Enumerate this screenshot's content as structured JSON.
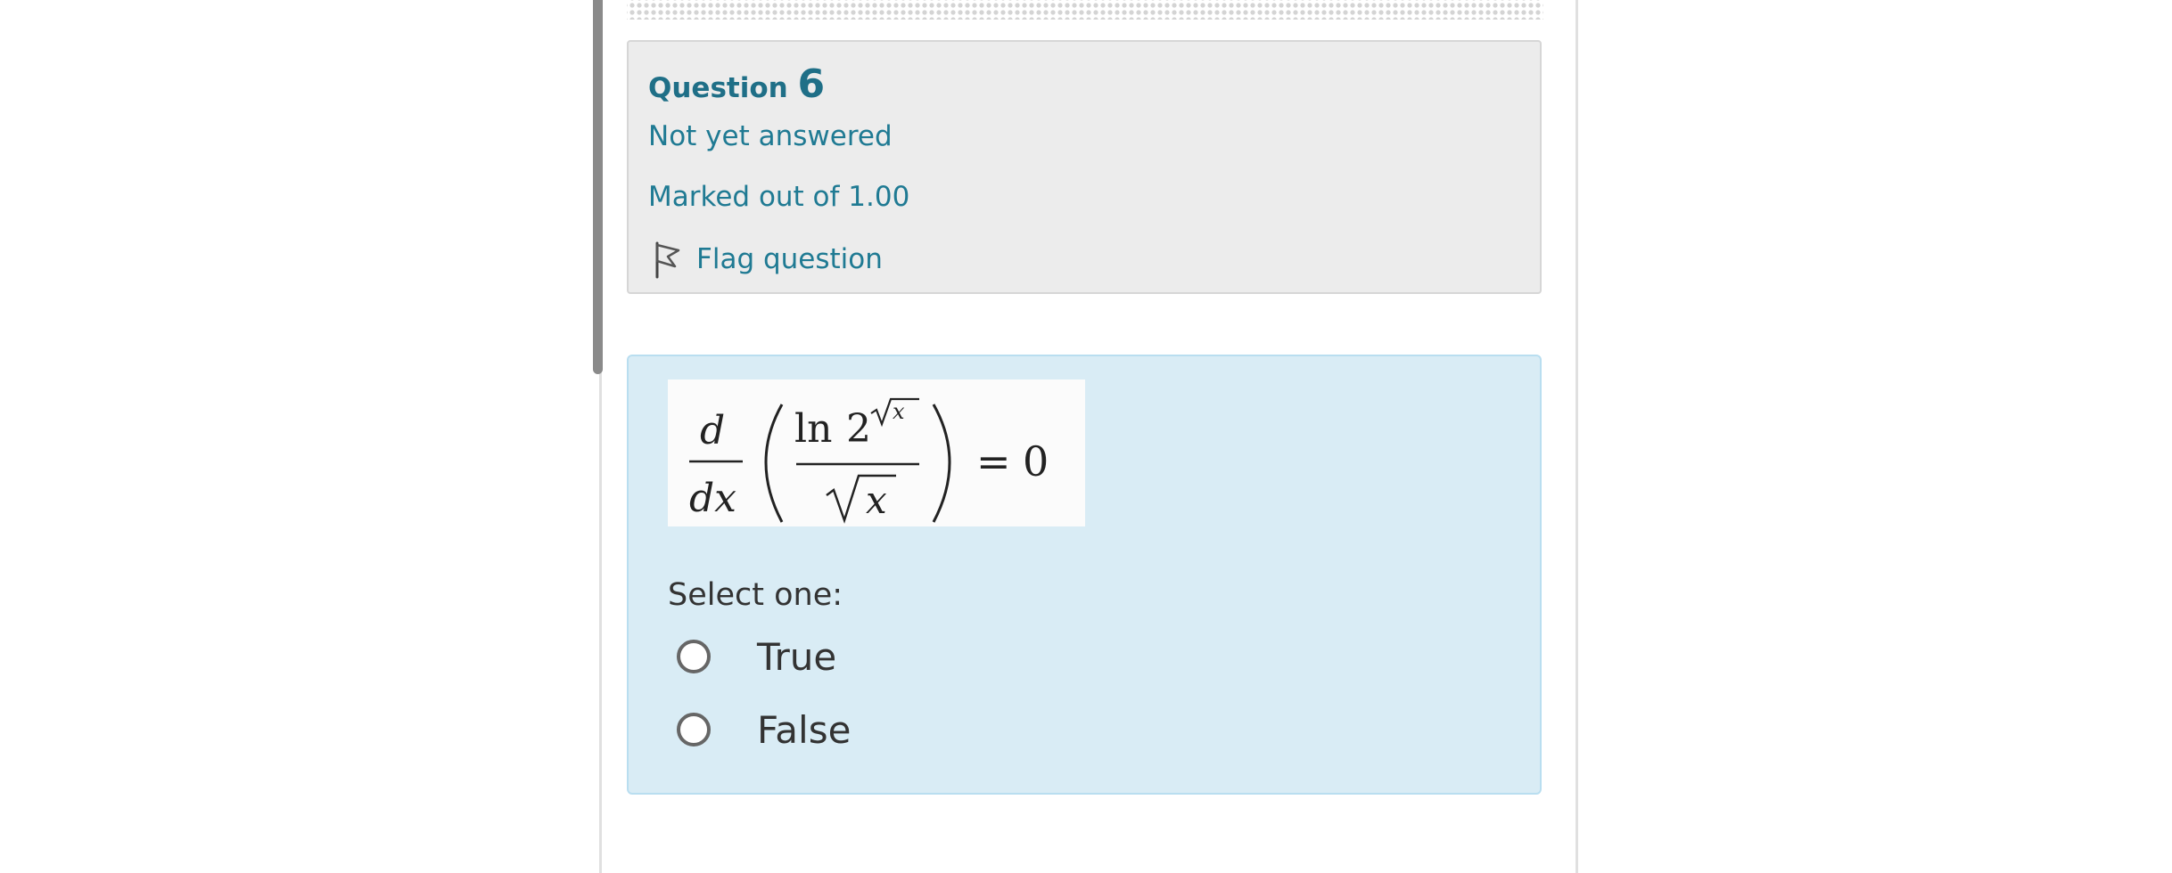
{
  "question_info": {
    "label": "Question",
    "number": "6",
    "state": "Not yet answered",
    "grade": "Marked out of 1.00",
    "flag_label": "Flag question"
  },
  "question_content": {
    "formula": {
      "d": "d",
      "dx": "dx",
      "ln": "ln",
      "two": "2",
      "x": "x",
      "equals": "=",
      "zero": "0"
    },
    "prompt": "Select one:",
    "options": [
      {
        "label": "True",
        "selected": false
      },
      {
        "label": "False",
        "selected": false
      }
    ]
  },
  "icons": {
    "flag": "flag-outline-icon",
    "radio": "radio-empty-icon"
  },
  "colors": {
    "info_background": "#ececec",
    "content_background": "#d9ecf5",
    "link_teal": "#1f7a93"
  }
}
